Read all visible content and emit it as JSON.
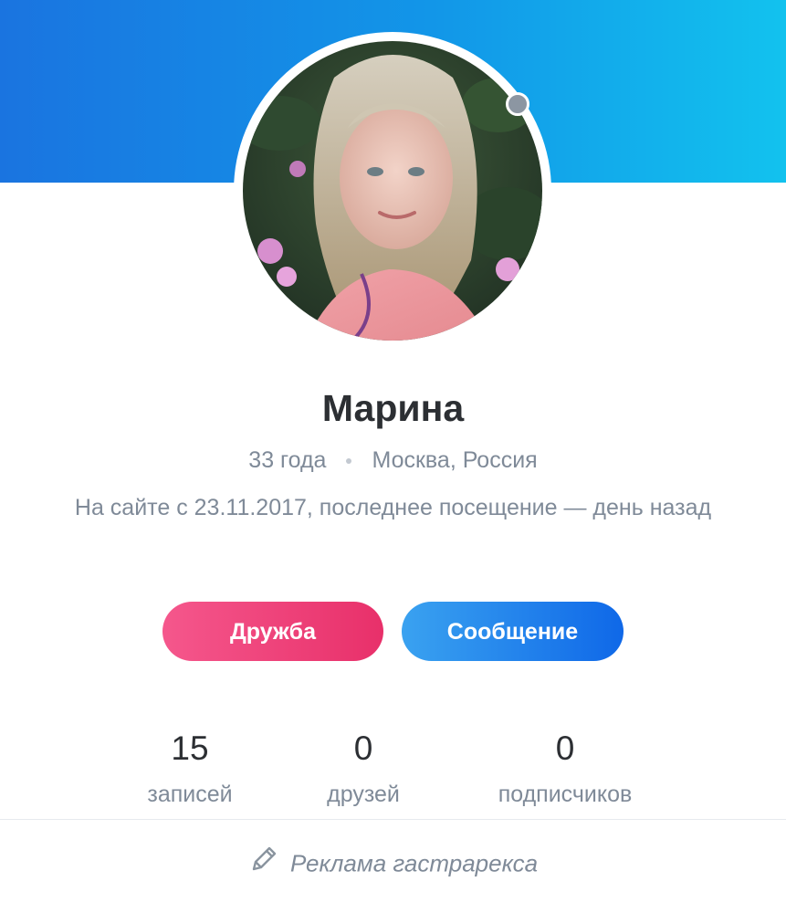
{
  "profile": {
    "name": "Марина",
    "age": "33 года",
    "location": "Москва, Россия",
    "last_visit": "На сайте с 23.11.2017, последнее посещение — день назад",
    "online_status_color": "#8c96a2"
  },
  "actions": {
    "friend_label": "Дружба",
    "message_label": "Сообщение"
  },
  "stats": [
    {
      "value": "15",
      "label": "записей"
    },
    {
      "value": "0",
      "label": "друзей"
    },
    {
      "value": "0",
      "label": "подписчиков"
    }
  ],
  "ad": {
    "label": "Реклама гастрарекса",
    "icon": "pencil-icon"
  },
  "colors": {
    "cover_start": "#1a74e0",
    "cover_end": "#12c2ee",
    "friend_button": "#e8306a",
    "message_button": "#0f68e8"
  }
}
